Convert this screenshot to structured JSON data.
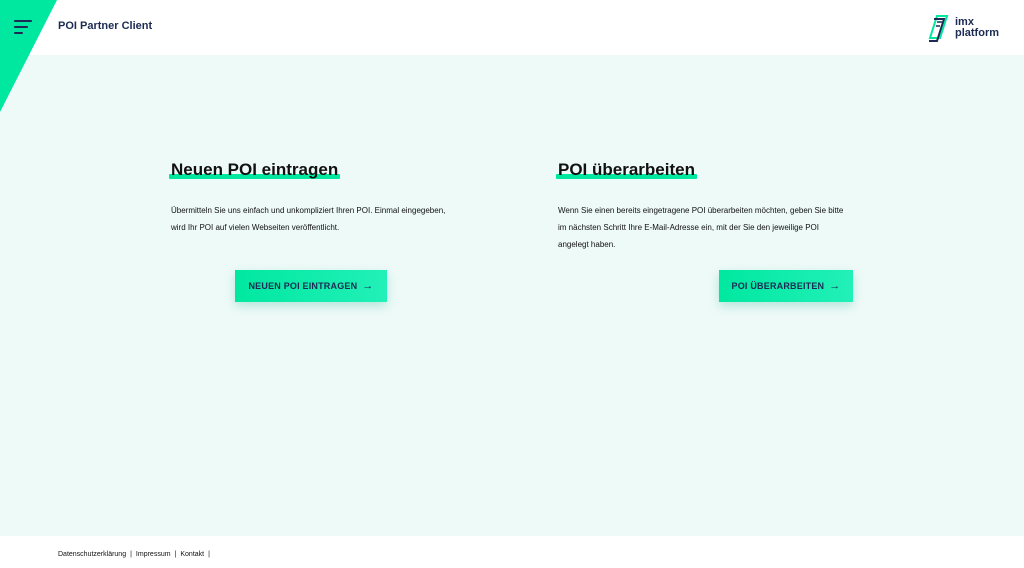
{
  "header": {
    "app_title": "POI Partner Client",
    "menu_icon": "hamburger-icon",
    "logo": {
      "line1": "imx",
      "line2": "platform",
      "icon": "imx-logo-icon"
    }
  },
  "cards": [
    {
      "title": "Neuen POI eintragen",
      "text": "Übermitteln Sie uns einfach und unkompliziert Ihren POI. Einmal eingegeben, wird Ihr POI auf vielen Webseiten veröffentlicht.",
      "button_label": "NEUEN POI EINTRAGEN",
      "button_icon": "arrow-right-icon"
    },
    {
      "title": "POI überarbeiten",
      "text": "Wenn Sie einen bereits eingetragene POI überarbeiten möchten, geben Sie bitte im nächsten Schritt Ihre E-Mail-Adresse ein, mit der Sie den jeweilige POI angelegt haben.",
      "button_label": "POI ÜBERARBEITEN",
      "button_icon": "arrow-right-icon"
    }
  ],
  "footer": {
    "links": [
      "Datenschutzerklärung",
      "Impressum",
      "Kontakt"
    ],
    "separator": "|"
  },
  "colors": {
    "accent": "#00e8a0",
    "navy": "#1c2b54",
    "background": "#eefaf8"
  }
}
